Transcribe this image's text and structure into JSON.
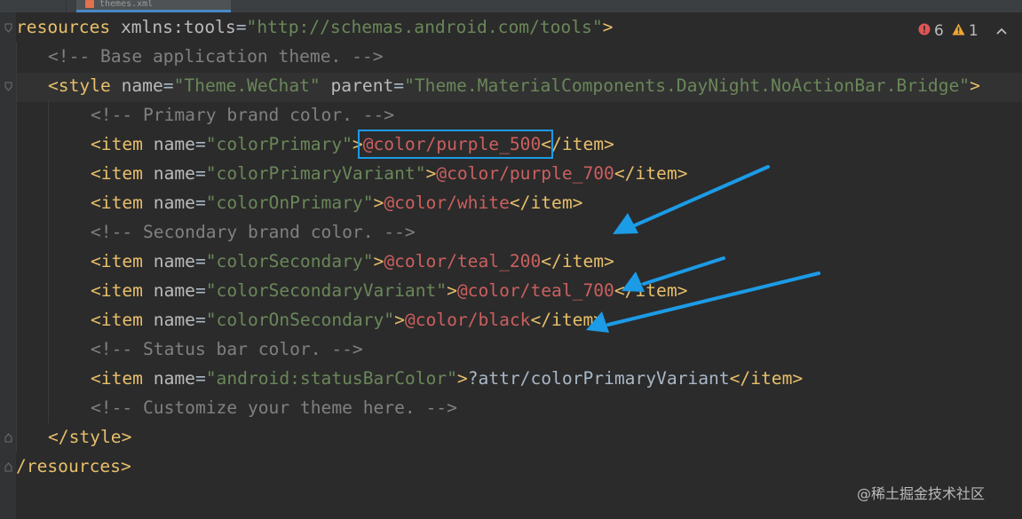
{
  "editor": {
    "tab_title": "themes.xml",
    "lines": [
      {
        "indent": 0,
        "tokens": [
          {
            "t": "tag",
            "s": "resources"
          },
          {
            "t": "plain",
            "s": " "
          },
          {
            "t": "attr",
            "s": "xmlns:tools"
          },
          {
            "t": "plain",
            "s": "="
          },
          {
            "t": "val",
            "s": "\"http://schemas.android.com/tools\""
          },
          {
            "t": "tag",
            "s": ">"
          }
        ]
      },
      {
        "indent": 1,
        "tokens": [
          {
            "t": "com",
            "s": "<!-- Base application theme. -->"
          }
        ]
      },
      {
        "indent": 1,
        "tokens": [
          {
            "t": "tag",
            "s": "<style"
          },
          {
            "t": "plain",
            "s": " "
          },
          {
            "t": "attr",
            "s": "name"
          },
          {
            "t": "plain",
            "s": "="
          },
          {
            "t": "val",
            "s": "\"Theme.WeChat\""
          },
          {
            "t": "plain",
            "s": " "
          },
          {
            "t": "attr",
            "s": "parent"
          },
          {
            "t": "plain",
            "s": "="
          },
          {
            "t": "val",
            "s": "\"Theme.MaterialComponents.DayNight.NoActionBar.Bridge\""
          },
          {
            "t": "tag",
            "s": ">"
          }
        ]
      },
      {
        "indent": 2,
        "tokens": [
          {
            "t": "com",
            "s": "<!-- Primary brand color. -->"
          }
        ]
      },
      {
        "indent": 2,
        "tokens": [
          {
            "t": "tag",
            "s": "<item"
          },
          {
            "t": "plain",
            "s": " "
          },
          {
            "t": "attr",
            "s": "name"
          },
          {
            "t": "plain",
            "s": "="
          },
          {
            "t": "val",
            "s": "\"colorPrimary\""
          },
          {
            "t": "tag",
            "s": ">"
          },
          {
            "t": "ref",
            "s": "@color/purple_500"
          },
          {
            "t": "tag",
            "s": "</item>"
          }
        ]
      },
      {
        "indent": 2,
        "tokens": [
          {
            "t": "tag",
            "s": "<item"
          },
          {
            "t": "plain",
            "s": " "
          },
          {
            "t": "attr",
            "s": "name"
          },
          {
            "t": "plain",
            "s": "="
          },
          {
            "t": "val",
            "s": "\"colorPrimaryVariant\""
          },
          {
            "t": "tag",
            "s": ">"
          },
          {
            "t": "ref",
            "s": "@color/purple_700"
          },
          {
            "t": "tag",
            "s": "</item>"
          }
        ]
      },
      {
        "indent": 2,
        "tokens": [
          {
            "t": "tag",
            "s": "<item"
          },
          {
            "t": "plain",
            "s": " "
          },
          {
            "t": "attr",
            "s": "name"
          },
          {
            "t": "plain",
            "s": "="
          },
          {
            "t": "val",
            "s": "\"colorOnPrimary\""
          },
          {
            "t": "tag",
            "s": ">"
          },
          {
            "t": "ref",
            "s": "@color/white"
          },
          {
            "t": "tag",
            "s": "</item>"
          }
        ]
      },
      {
        "indent": 2,
        "tokens": [
          {
            "t": "com",
            "s": "<!-- Secondary brand color. -->"
          }
        ]
      },
      {
        "indent": 2,
        "tokens": [
          {
            "t": "tag",
            "s": "<item"
          },
          {
            "t": "plain",
            "s": " "
          },
          {
            "t": "attr",
            "s": "name"
          },
          {
            "t": "plain",
            "s": "="
          },
          {
            "t": "val",
            "s": "\"colorSecondary\""
          },
          {
            "t": "tag",
            "s": ">"
          },
          {
            "t": "ref",
            "s": "@color/teal_200"
          },
          {
            "t": "tag",
            "s": "</item>"
          }
        ]
      },
      {
        "indent": 2,
        "tokens": [
          {
            "t": "tag",
            "s": "<item"
          },
          {
            "t": "plain",
            "s": " "
          },
          {
            "t": "attr",
            "s": "name"
          },
          {
            "t": "plain",
            "s": "="
          },
          {
            "t": "val",
            "s": "\"colorSecondaryVariant\""
          },
          {
            "t": "tag",
            "s": ">"
          },
          {
            "t": "ref",
            "s": "@color/teal_700"
          },
          {
            "t": "tag",
            "s": "</item>"
          }
        ]
      },
      {
        "indent": 2,
        "tokens": [
          {
            "t": "tag",
            "s": "<item"
          },
          {
            "t": "plain",
            "s": " "
          },
          {
            "t": "attr",
            "s": "name"
          },
          {
            "t": "plain",
            "s": "="
          },
          {
            "t": "val",
            "s": "\"colorOnSecondary\""
          },
          {
            "t": "tag",
            "s": ">"
          },
          {
            "t": "ref",
            "s": "@color/black"
          },
          {
            "t": "tag",
            "s": "</item>"
          }
        ]
      },
      {
        "indent": 2,
        "tokens": [
          {
            "t": "com",
            "s": "<!-- Status bar color. -->"
          }
        ]
      },
      {
        "indent": 2,
        "tokens": [
          {
            "t": "tag",
            "s": "<item"
          },
          {
            "t": "plain",
            "s": " "
          },
          {
            "t": "attr",
            "s": "name"
          },
          {
            "t": "plain",
            "s": "="
          },
          {
            "t": "val",
            "s": "\"android:statusBarColor\""
          },
          {
            "t": "tag",
            "s": ">"
          },
          {
            "t": "plain",
            "s": "?attr/colorPrimaryVariant"
          },
          {
            "t": "tag",
            "s": "</item>"
          }
        ]
      },
      {
        "indent": 2,
        "tokens": [
          {
            "t": "com",
            "s": "<!-- Customize your theme here. -->"
          }
        ]
      },
      {
        "indent": 1,
        "tokens": [
          {
            "t": "tag",
            "s": "</style>"
          }
        ]
      },
      {
        "indent": 0,
        "tokens": [
          {
            "t": "tag",
            "s": "/resources>"
          }
        ]
      }
    ]
  },
  "inspections": {
    "error_count": "6",
    "warning_count": "1",
    "icons": {
      "error": "error-icon",
      "warning": "warning-icon",
      "collapse": "chevron-up-icon"
    }
  },
  "annotations": {
    "highlight_color": "#1c9be6",
    "arrow_color": "#1c9be6"
  },
  "watermark": "@稀土掘金技术社区",
  "colors": {
    "background": "#2b2b2b",
    "tag": "#e8bf6a",
    "attribute": "#bababa",
    "string": "#6a8759",
    "comment": "#808080",
    "reference": "#cc5f5f",
    "text": "#a9b7c6"
  }
}
